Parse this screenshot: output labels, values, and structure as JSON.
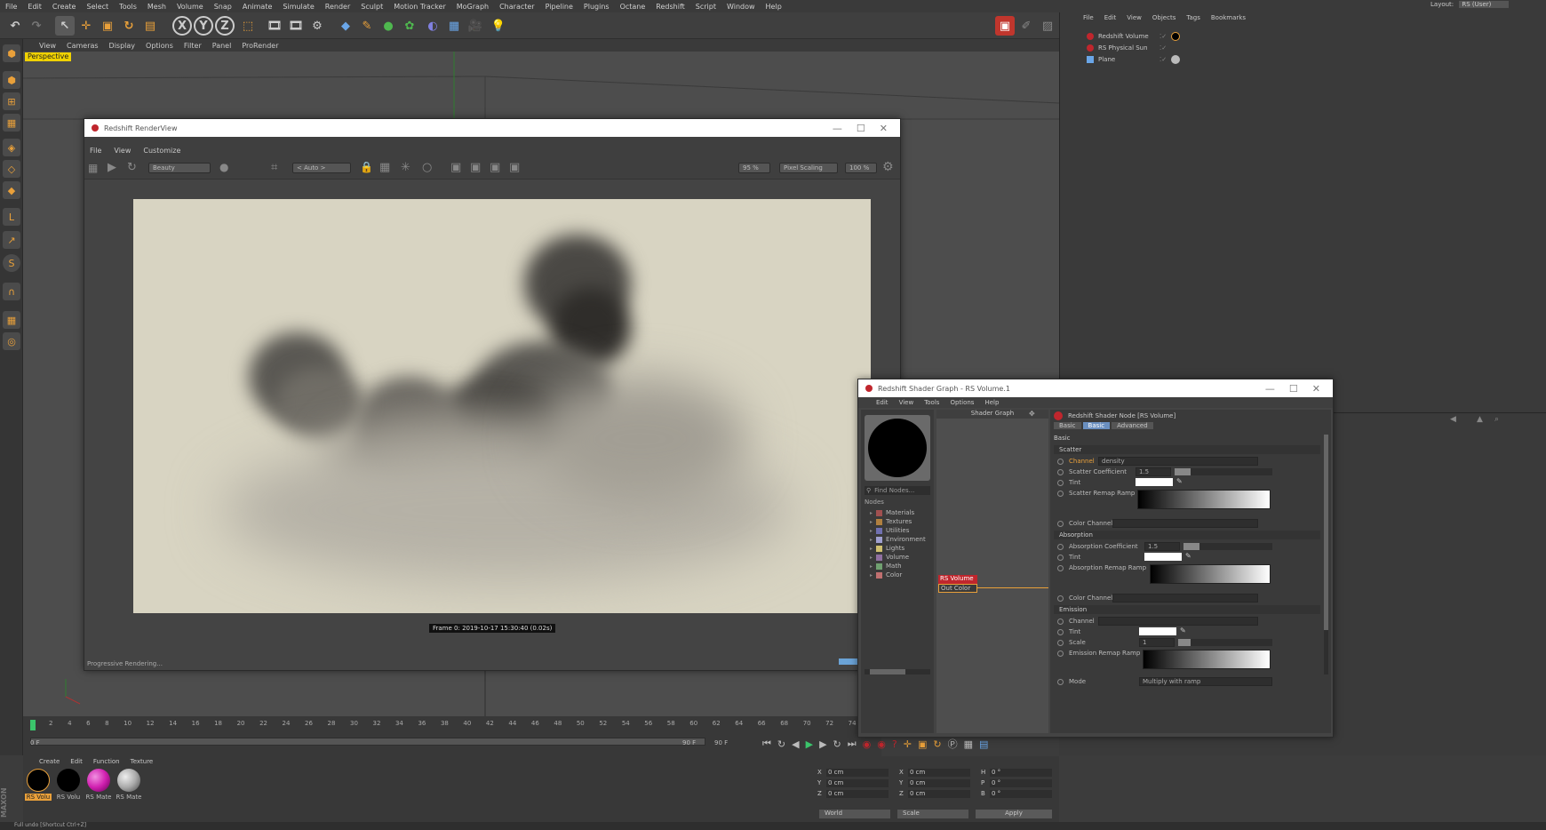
{
  "menu": [
    "File",
    "Edit",
    "Create",
    "Select",
    "Tools",
    "Mesh",
    "Volume",
    "Snap",
    "Animate",
    "Simulate",
    "Render",
    "Sculpt",
    "Motion Tracker",
    "MoGraph",
    "Character",
    "Pipeline",
    "Plugins",
    "Octane",
    "Redshift",
    "Script",
    "Window",
    "Help"
  ],
  "layout": {
    "label": "Layout:",
    "value": "RS (User)"
  },
  "viewport": {
    "menu": [
      "View",
      "Cameras",
      "Display",
      "Options",
      "Filter",
      "Panel",
      "ProRender"
    ],
    "camera": "Perspective"
  },
  "renderview": {
    "title": "Redshift RenderView",
    "menu": [
      "File",
      "View",
      "Customize"
    ],
    "aov": "Beauty",
    "auto": "< Auto >",
    "zoom": "95 %",
    "scaling": "Pixel Scaling",
    "zoom2": "100 %",
    "frame_info": "Frame  0:  2019-10-17  15:30:40  (0.02s)",
    "status": "Progressive Rendering..."
  },
  "objects": {
    "menu": [
      "File",
      "Edit",
      "View",
      "Objects",
      "Tags",
      "Bookmarks"
    ],
    "items": [
      "Redshift Volume",
      "RS Physical Sun",
      "Plane"
    ]
  },
  "timeline": {
    "ticks": [
      "0",
      "2",
      "4",
      "6",
      "8",
      "10",
      "12",
      "14",
      "16",
      "18",
      "20",
      "22",
      "24",
      "26",
      "28",
      "30",
      "32",
      "34",
      "36",
      "38",
      "40",
      "42",
      "44",
      "46",
      "48",
      "50",
      "52",
      "54",
      "56",
      "58",
      "60",
      "62",
      "64",
      "66",
      "68",
      "70",
      "72",
      "74"
    ],
    "start": "0 F",
    "end": "90 F",
    "end2": "90 F"
  },
  "materials": {
    "menu": [
      "Create",
      "Edit",
      "Function",
      "Texture"
    ],
    "items": [
      {
        "label": "RS Volu",
        "color": "#000000"
      },
      {
        "label": "RS Volu",
        "color": "#000000"
      },
      {
        "label": "RS Mate",
        "color": "#d020b0"
      },
      {
        "label": "RS Mate",
        "color": "#aaaaaa"
      }
    ]
  },
  "coords": {
    "rows": [
      [
        "X",
        "0 cm",
        "X",
        "0 cm",
        "H",
        "0 °"
      ],
      [
        "Y",
        "0 cm",
        "Y",
        "0 cm",
        "P",
        "0 °"
      ],
      [
        "Z",
        "0 cm",
        "Z",
        "0 cm",
        "B",
        "0 °"
      ]
    ],
    "mode1": "World",
    "mode2": "Scale",
    "apply": "Apply"
  },
  "status_bar": "Full undo [Shortcut Ctrl+Z]",
  "shadergraph": {
    "title": "Redshift Shader Graph - RS Volume.1",
    "menu": [
      "Edit",
      "View",
      "Tools",
      "Options",
      "Help"
    ],
    "graph_label": "Shader Graph",
    "find": "Find Nodes...",
    "nodes_label": "Nodes",
    "categories": [
      {
        "label": "Materials",
        "color": "#a05050"
      },
      {
        "label": "Textures",
        "color": "#b08040"
      },
      {
        "label": "Utilities",
        "color": "#7070b0"
      },
      {
        "label": "Environment",
        "color": "#a0a0d0"
      },
      {
        "label": "Lights",
        "color": "#d0c070"
      },
      {
        "label": "Volume",
        "color": "#9070a0"
      },
      {
        "label": "Math",
        "color": "#70a070"
      },
      {
        "label": "Color",
        "color": "#c07070"
      }
    ],
    "node_name": "RS Volume",
    "node_port": "Out Color",
    "prop_title": "Redshift Shader Node [RS Volume]",
    "tabs": [
      "Basic",
      "Basic",
      "Advanced"
    ],
    "basic_header": "Basic",
    "scatter": {
      "header": "Scatter",
      "channel_label": "Channel",
      "channel_value": "density",
      "coef_label": "Scatter Coefficient",
      "coef_value": "1.5",
      "tint": "Tint",
      "ramp": "Scatter Remap Ramp",
      "color_channel": "Color Channel"
    },
    "absorption": {
      "header": "Absorption",
      "coef_label": "Absorption Coefficient",
      "coef_value": "1.5",
      "tint": "Tint",
      "ramp": "Absorption Remap Ramp",
      "color_channel": "Color Channel"
    },
    "emission": {
      "header": "Emission",
      "channel": "Channel",
      "tint": "Tint",
      "scale": "Scale",
      "scale_value": "1",
      "ramp": "Emission Remap Ramp",
      "mode": "Mode",
      "mode_value": "Multiply with ramp"
    }
  }
}
